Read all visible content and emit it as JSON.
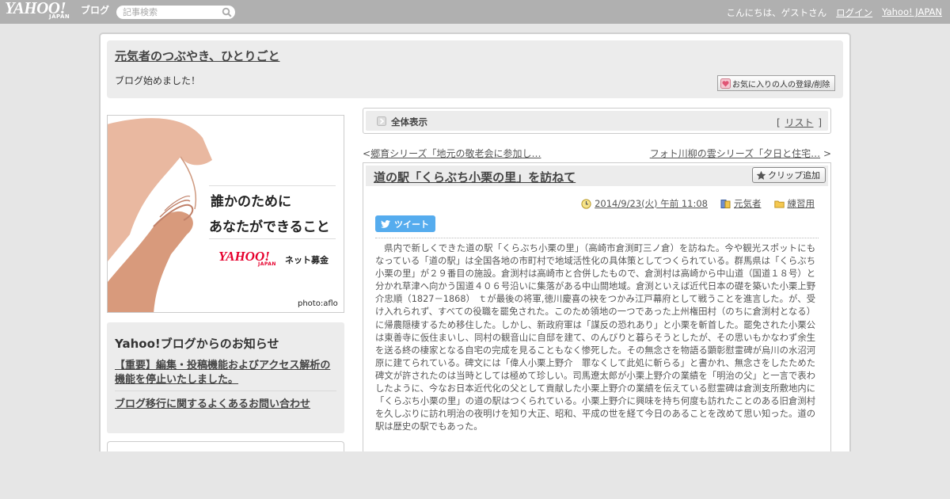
{
  "topbar": {
    "logo": "YAHOO!",
    "logo_sub": "JAPAN",
    "blog_label": "ブログ",
    "search_placeholder": "記事検索",
    "greeting": "こんにちは、ゲストさん",
    "login": "ログイン",
    "yahoo_japan": "Yahoo! JAPAN"
  },
  "header": {
    "blog_title": "元気者のつぶやき、ひとりごと",
    "description": "ブログ始めました！",
    "fav_button": "お気に入りの人の登録/削除"
  },
  "banner": {
    "line1": "誰かのために",
    "line2": "あなたができること",
    "logo": "YAHOO!",
    "logo_sub": "JAPAN",
    "net": "ネット募金",
    "credit": "photo:aflo"
  },
  "notice": {
    "title": "Yahoo!ブログからのお知らせ",
    "items": [
      "【重要】編集・投稿機能およびアクセス解析の機能を停止いたしました。",
      "ブログ移行に関するよくあるお問い合わせ"
    ]
  },
  "view_bar": {
    "label": "全体表示",
    "list_link": "リスト",
    "bracket_open": "[",
    "bracket_close": "]"
  },
  "nav": {
    "prev_arrow": "<",
    "prev": "郷育シリーズ「地元の敬老会に参加し…",
    "next": "フォト川柳の雲シリーズ「夕日と住宅…",
    "next_arrow": ">"
  },
  "article": {
    "title": "道の駅「くらぶち小栗の里」を訪ねて",
    "clip_button": "クリップ追加",
    "datetime": "2014/9/23(火) 午前 11:08",
    "author": "元気者",
    "category": "練習用",
    "tweet": "ツイート",
    "body": "県内で新しくできた道の駅「くらぶち小栗の里」（高崎市倉渕町三ノ倉）を訪ねた。今や観光スポットにもなっている「道の駅」は全国各地の市町村で地域活性化の具体策としてつくられている。群馬県は「くらぶち小栗の里」が２９番目の施設。倉渕村は高崎市と合併したもので、倉渕村は高崎から中山道（国道１８号）と分かれ草津へ向かう国道４０６号沿いに集落がある中山間地域。倉渕といえば近代日本の礎を築いた小栗上野介忠順（1827－1868） ｔが最後の将軍,徳川慶喜の袂をつかみ江戸幕府として戦うことを進言した。が、受け入れられず、すべての役職を罷免された。このため領地の一つであった上州権田村（のちに倉渕村となる）に帰農隠棲するため移住した。しかし、新政府軍は「謀反の恐れあり」と小栗を斬首した。罷免された小栗公は東善寺に仮住まいし、同村の観音山に自邸を建て、のんびりと暮らそうとしたが、その思いもかなわず余生を送る終の棲家となる自宅の完成を見ることもなく惨死した。その無念さを物語る顕彰慰霊碑が烏川の水沼河原に建てられている。碑文には「偉人小栗上野介　罪なくして此処に斬らる」と書かれ、無念さをしたためた碑文が許されたのは当時としては極めて珍しい。司馬遼太郎が小栗上野介の業績を「明治の父」と一言で表わしたように、今なお日本近代化の父として貢献した小栗上野介の業績を伝えている慰霊碑は倉渕支所敷地内に「くらぶち小栗の里」の道の駅はつくられている。小栗上野介に興味を持ち何度も訪れたことのある旧倉渕村を久しぶりに訪れ明治の夜明けを知り大正、昭和、平成の世を経て今日のあることを改めて思い知った。道の駅は歴史の駅でもあった。"
  },
  "colors": {
    "topbar": "#b0b0b0",
    "panel": "#ececec",
    "tweet": "#55acee",
    "yahoo_red": "#e6002d"
  }
}
